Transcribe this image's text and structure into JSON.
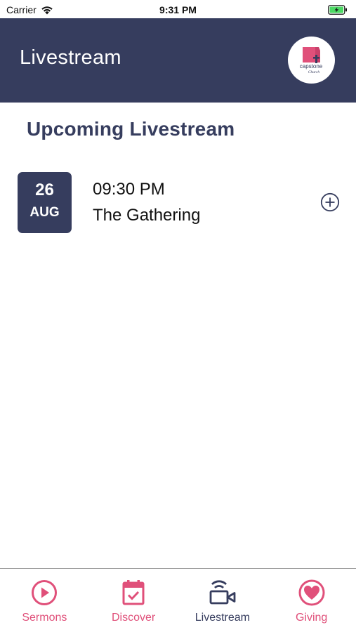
{
  "status_bar": {
    "carrier": "Carrier",
    "time": "9:31 PM"
  },
  "header": {
    "title": "Livestream",
    "logo_text": "capstone",
    "logo_subtext": "Church"
  },
  "main": {
    "section_title": "Upcoming Livestream",
    "events": [
      {
        "day": "26",
        "month": "AUG",
        "time": "09:30 PM",
        "name": "The Gathering",
        "action_icon": "plus-circle-icon"
      }
    ]
  },
  "tab_bar": {
    "tabs": [
      {
        "label": "Sermons",
        "icon": "play-circle-icon",
        "active": false
      },
      {
        "label": "Discover",
        "icon": "calendar-check-icon",
        "active": false
      },
      {
        "label": "Livestream",
        "icon": "video-broadcast-icon",
        "active": true
      },
      {
        "label": "Giving",
        "icon": "heart-icon",
        "active": false
      }
    ]
  },
  "colors": {
    "navy": "#363d5e",
    "pink": "#e0507a",
    "battery_green": "#4cd964"
  }
}
